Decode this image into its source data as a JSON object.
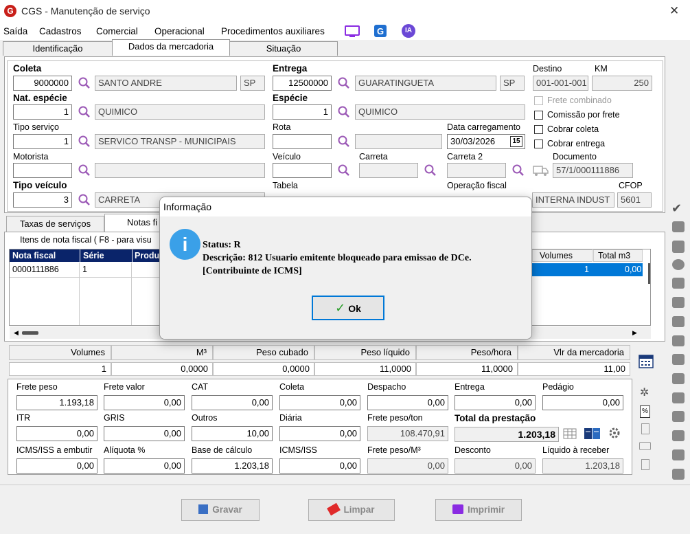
{
  "window": {
    "title": "CGS - Manutenção de serviço",
    "app_logo": "G"
  },
  "menu": [
    "Saída",
    "Cadastros",
    "Comercial",
    "Operacional",
    "Procedimentos auxiliares"
  ],
  "menu_icons": {
    "ia_label": "IA"
  },
  "tabs": [
    "Identificação",
    "Dados da mercadoria",
    "Situação"
  ],
  "fields": {
    "coleta_label": "Coleta",
    "coleta_code": "9000000",
    "coleta_city": "SANTO ANDRE",
    "coleta_uf": "SP",
    "entrega_label": "Entrega",
    "entrega_code": "12500000",
    "entrega_city": "GUARATINGUETA",
    "entrega_uf": "SP",
    "destino_label": "Destino",
    "destino_value": "001-001-001",
    "km_label": "KM",
    "km_value": "250",
    "nat_label": "Nat. espécie",
    "nat_code": "1",
    "nat_desc": "QUIMICO",
    "especie_label": "Espécie",
    "especie_code": "1",
    "especie_desc": "QUIMICO",
    "frete_combinado": "Frete combinado",
    "comissao": "Comissão por frete",
    "cobrar_coleta": "Cobrar coleta",
    "cobrar_entrega": "Cobrar entrega",
    "tipo_servico_label": "Tipo serviço",
    "tipo_servico_code": "1",
    "tipo_servico_desc": "SERVICO TRANSP - MUNICIPAIS",
    "rota_label": "Rota",
    "data_label": "Data carregamento",
    "data_value": "30/03/2026",
    "cal_label": "15",
    "motorista_label": "Motorista",
    "veiculo_label": "Veículo",
    "carreta_label": "Carreta",
    "carreta2_label": "Carreta 2",
    "documento_label": "Documento",
    "documento_value": "57/1/000111886",
    "tipo_veiculo_label": "Tipo veículo",
    "tipo_veiculo_code": "3",
    "tipo_veiculo_desc": "CARRETA",
    "tabela_label": "Tabela",
    "operacao_label": "Operação fiscal",
    "operacao_value": "INTERNA INDUST",
    "cfop_label": "CFOP",
    "cfop_value": "5601"
  },
  "subtabs": [
    "Taxas de serviços",
    "Notas fi"
  ],
  "items": {
    "group_label": "Itens de nota fiscal ( F8 - para visu",
    "headers": [
      "Nota fiscal",
      "Série",
      "Produ"
    ],
    "right_headers": [
      "Volumes",
      "Total m3"
    ],
    "row": {
      "nota": "0000111886",
      "serie": "1",
      "volumes": "1",
      "total_m3": "0,00"
    }
  },
  "totals": {
    "headers": [
      "Volumes",
      "M³",
      "Peso cubado",
      "Peso líquido",
      "Peso/hora",
      "Vlr da mercadoria"
    ],
    "values": [
      "1",
      "0,0000",
      "0,0000",
      "11,0000",
      "11,0000",
      "11,00"
    ]
  },
  "freight": {
    "row1": [
      [
        "Frete peso",
        "1.193,18"
      ],
      [
        "Frete valor",
        "0,00"
      ],
      [
        "CAT",
        "0,00"
      ],
      [
        "Coleta",
        "0,00"
      ],
      [
        "Despacho",
        "0,00"
      ],
      [
        "Entrega",
        "0,00"
      ],
      [
        "Pedágio",
        "0,00"
      ]
    ],
    "row2": [
      [
        "ITR",
        "0,00"
      ],
      [
        "GRIS",
        "0,00"
      ],
      [
        "Outros",
        "10,00"
      ],
      [
        "Diária",
        "0,00"
      ],
      [
        "Frete peso/ton",
        "108.470,91"
      ]
    ],
    "total_label": "Total da prestação",
    "total_value": "1.203,18",
    "row3": [
      [
        "ICMS/ISS a embutir",
        "0,00"
      ],
      [
        "Alíquota %",
        "0,00"
      ],
      [
        "Base de cálculo",
        "1.203,18"
      ],
      [
        "ICMS/ISS",
        "0,00"
      ],
      [
        "Frete peso/M³",
        "0,00"
      ],
      [
        "Desconto",
        "0,00"
      ],
      [
        "Líquido à receber",
        "1.203,18"
      ]
    ]
  },
  "buttons": {
    "gravar": "Gravar",
    "limpar": "Limpar",
    "imprimir": "Imprimir"
  },
  "dialog": {
    "title": "Informação",
    "line1": "Status: R",
    "line2": "Descrição: 812 Usuario emitente bloqueado para emissao de DCe.",
    "line3": "[Contribuinte de ICMS]",
    "ok": "Ok",
    "icon_glyph": "i"
  },
  "colors": {
    "accent": "#0078d7",
    "dialog_icon": "#3aa0e8",
    "menu_icon": "#8a2be2"
  }
}
